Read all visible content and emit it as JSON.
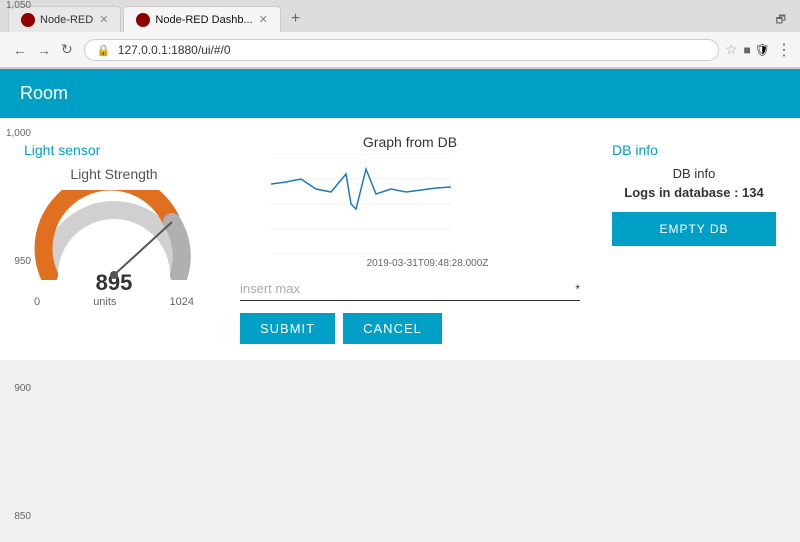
{
  "browser": {
    "tabs": [
      {
        "id": "tab1",
        "label": "Node-RED",
        "icon": "node-red",
        "active": false
      },
      {
        "id": "tab2",
        "label": "Node-RED Dashb...",
        "icon": "dashboard",
        "active": true
      }
    ],
    "url": "127.0.0.1:1880/ui/#/0",
    "star": "☆",
    "extension_icons": [
      "■",
      "🛡"
    ],
    "menu": "⋮"
  },
  "app": {
    "header": "Room"
  },
  "light_sensor": {
    "title": "Light sensor",
    "gauge_label": "Light Strength",
    "value": "895",
    "units": "units",
    "min": "0",
    "max": "1024",
    "colors": {
      "orange": "#e07020",
      "gray": "#c0c0c0",
      "track": "#e0e0e0"
    }
  },
  "graph": {
    "title": "Graph from DB",
    "y_labels": [
      "1,050",
      "1,000",
      "950",
      "900",
      "850"
    ],
    "x_label": "2019-03-31T09:48:28.000Z",
    "line_color": "#1a7abf"
  },
  "form": {
    "input_placeholder": "insert max",
    "required_marker": "*",
    "submit_label": "SUBMIT",
    "cancel_label": "CANCEL"
  },
  "db_info": {
    "title": "DB info",
    "info_label": "DB info",
    "logs_label": "Logs in database : 134",
    "empty_db_label": "EMPTY DB"
  }
}
